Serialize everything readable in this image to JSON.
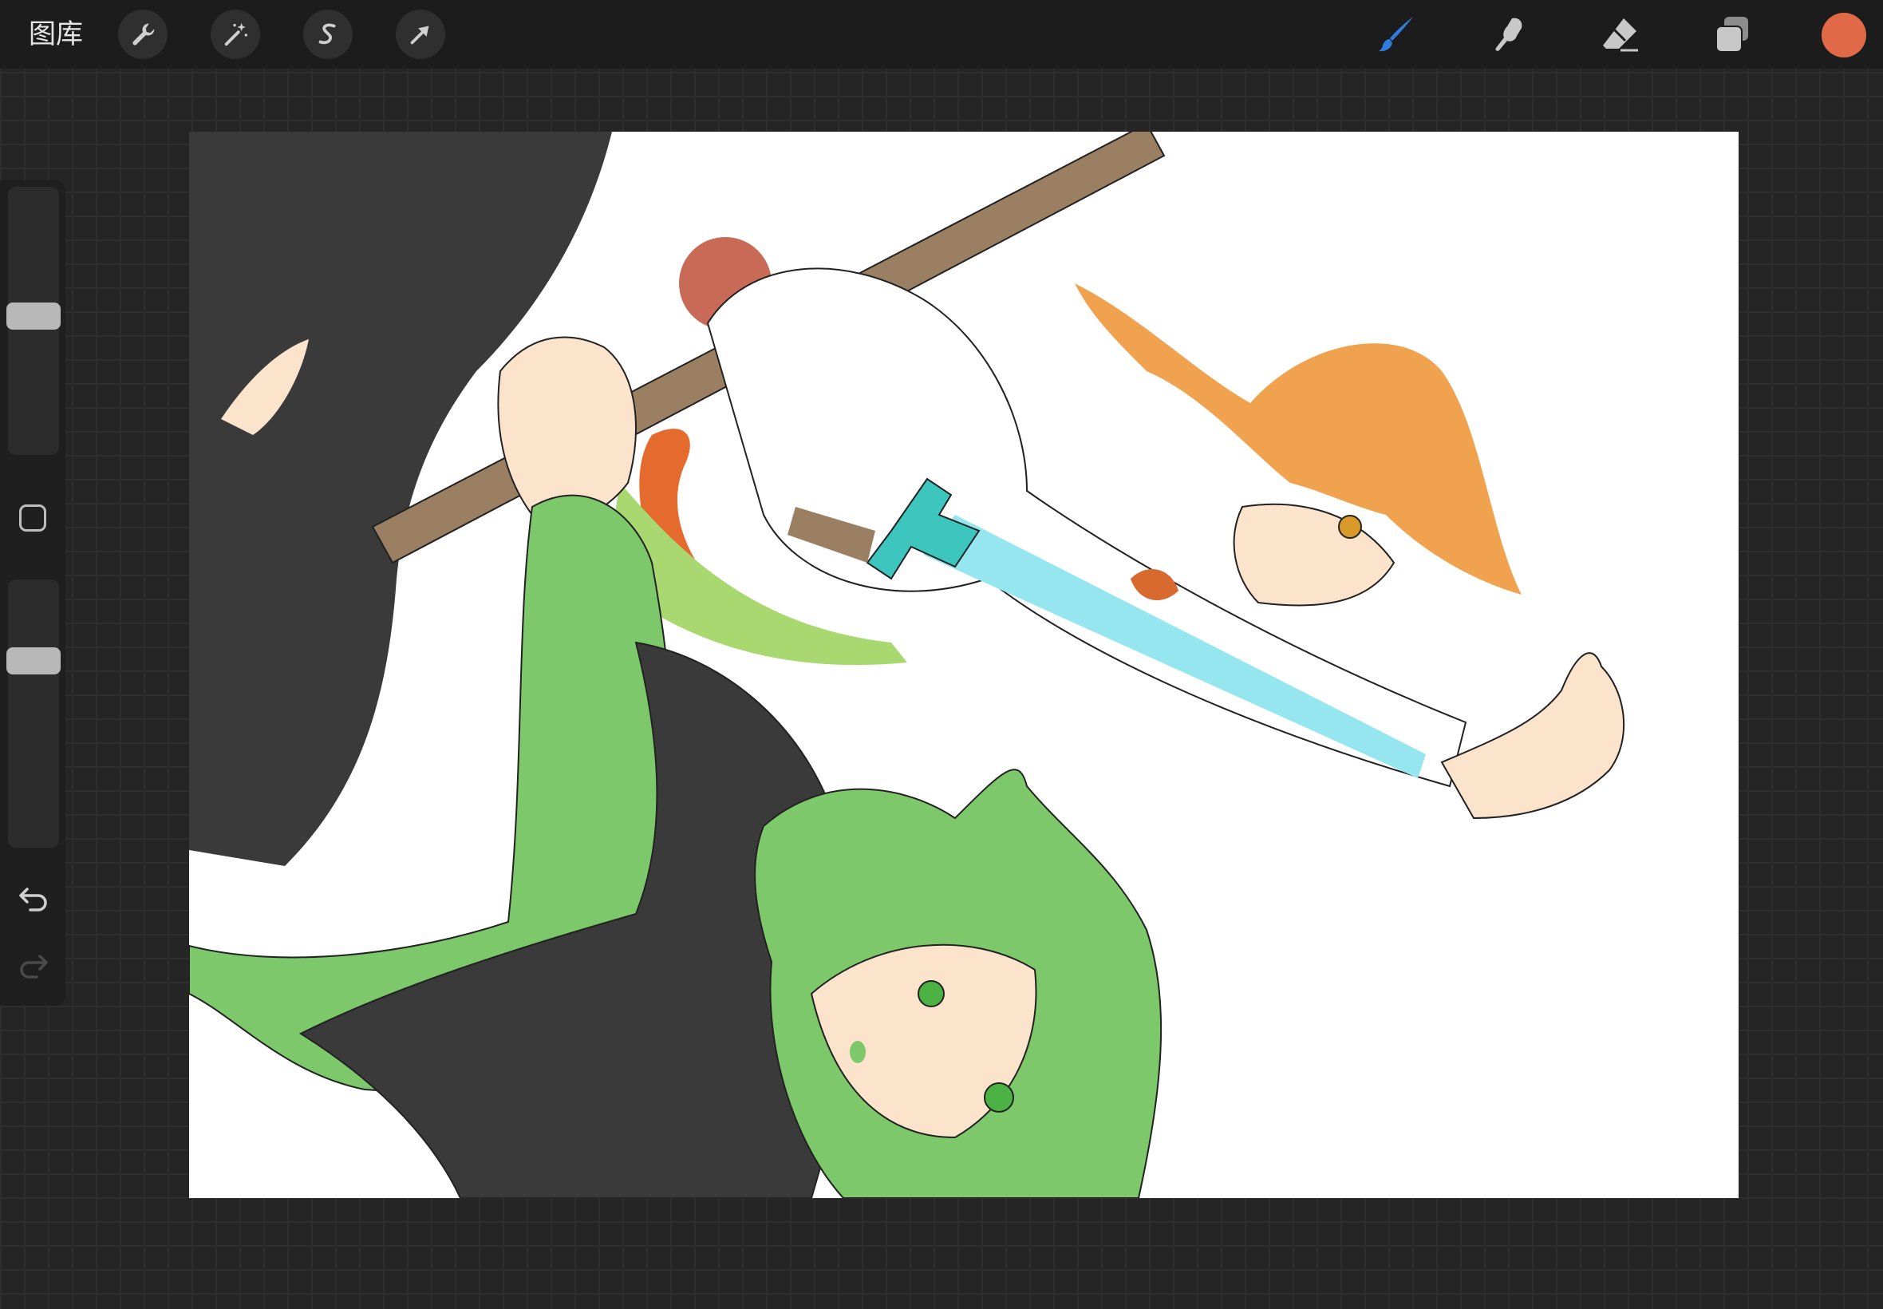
{
  "topbar": {
    "gallery_label": "图库",
    "left_tools": [
      {
        "name": "actions",
        "icon": "wrench-icon"
      },
      {
        "name": "adjustments",
        "icon": "magic-wand-icon"
      },
      {
        "name": "selection",
        "icon": "selection-s-icon"
      },
      {
        "name": "transform",
        "icon": "arrow-cursor-icon"
      }
    ],
    "right_tools": [
      {
        "name": "brush",
        "icon": "brush-icon",
        "active": true
      },
      {
        "name": "smudge",
        "icon": "smudge-finger-icon"
      },
      {
        "name": "eraser",
        "icon": "eraser-icon"
      },
      {
        "name": "layers",
        "icon": "layers-icon"
      }
    ],
    "current_color": "#e06a47",
    "active_accent": "#2f7be0"
  },
  "sidebar": {
    "brush_size_level": 0.52,
    "opacity_level": 0.72,
    "modifier_icon": "square-modifier-icon",
    "undo_icon": "undo-icon",
    "redo_icon": "redo-icon"
  },
  "canvas": {
    "background": "#ffffff",
    "colors": {
      "hair_green": "#7dc86a",
      "hair_orange": "#f0a24e",
      "sword_blade": "#96e6f0",
      "sword_hilt": "#3cc6be",
      "staff": "#9b7f62",
      "cloth_dark": "#3a3a3a",
      "skin": "#fbe3cc",
      "red_ball": "#c86a55"
    }
  }
}
